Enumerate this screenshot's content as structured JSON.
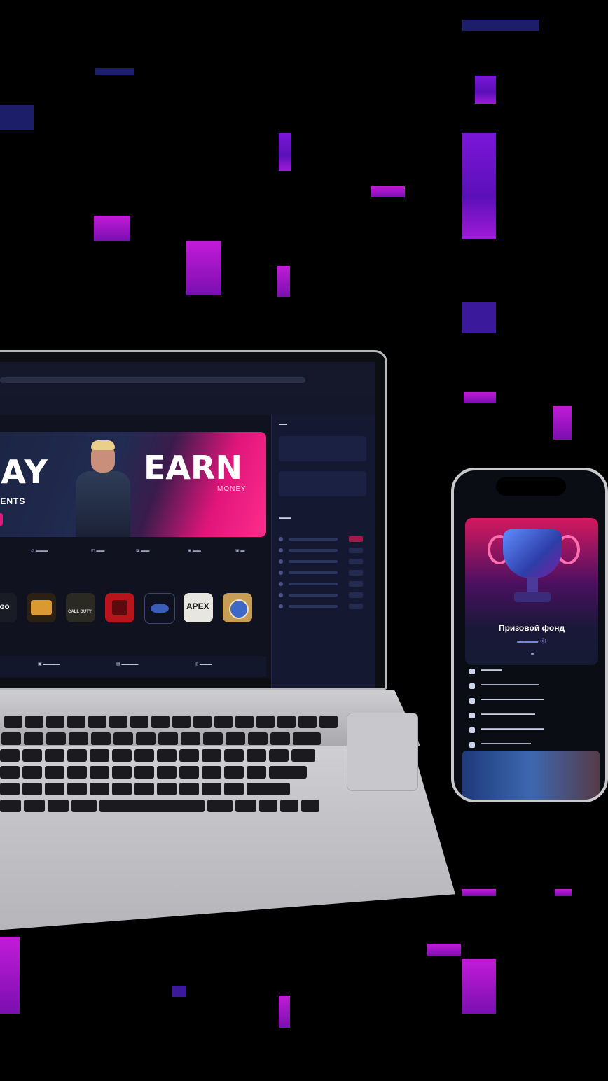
{
  "colors": {
    "background": "#000000",
    "accent_magenta": "#e0167c",
    "pixel_purple": "#7a16d8",
    "screen_bg": "#10131f"
  },
  "laptop": {
    "banner": {
      "play_text": "LAY",
      "earn_text": "EARN",
      "money_text": "MONEY",
      "tournaments_text": "NAMENTS"
    },
    "icons": [
      "chevron-left-icon",
      "chevron-right-icon"
    ],
    "games": [
      {
        "name": "CS:GO",
        "short": "CS:GO"
      },
      {
        "name": "PUBG",
        "short": ""
      },
      {
        "name": "Call of Duty",
        "short": "CALL DUTY"
      },
      {
        "name": "Dota 2",
        "short": ""
      },
      {
        "name": "StarCraft II",
        "short": ""
      },
      {
        "name": "Apex Legends",
        "short": "APEX"
      },
      {
        "name": "Hearthstone",
        "short": ""
      }
    ]
  },
  "phone": {
    "prize_title": "Призовой фонд"
  }
}
